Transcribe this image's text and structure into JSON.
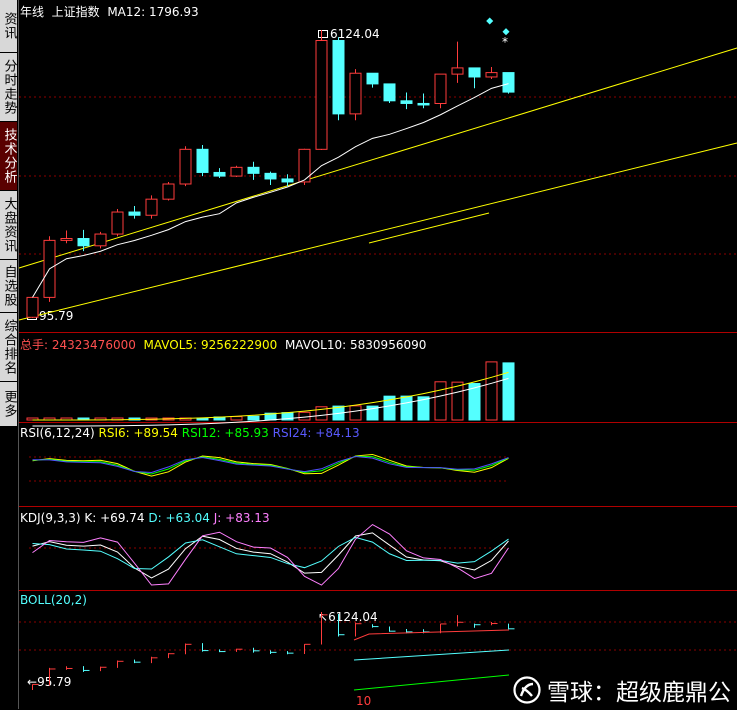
{
  "sidebar": {
    "tabs": [
      {
        "label": "资讯",
        "active": false
      },
      {
        "label": "分时走势",
        "active": false
      },
      {
        "label": "技术分析",
        "active": true
      },
      {
        "label": "大盘资讯",
        "active": false
      },
      {
        "label": "自选股",
        "active": false
      },
      {
        "label": "综合排名",
        "active": false
      },
      {
        "label": "更多",
        "active": false
      }
    ]
  },
  "main": {
    "period": "年线",
    "index_name": "上证指数",
    "ma_label": "MA12:",
    "ma_value": "1796.93",
    "high_label": "6124.04",
    "low_label": "95.79",
    "star": "*"
  },
  "volume": {
    "total_label": "总手:",
    "total_value": "24323476000",
    "mavol5_label": "MAVOL5:",
    "mavol5_value": "9256222900",
    "mavol10_label": "MAVOL10:",
    "mavol10_value": "5830956090"
  },
  "rsi": {
    "title": "RSI(6,12,24)",
    "rsi6_label": "RSI6:",
    "rsi6_value": "+89.54",
    "rsi12_label": "RSI12:",
    "rsi12_value": "+85.93",
    "rsi24_label": "RSI24:",
    "rsi24_value": "+84.13"
  },
  "kdj": {
    "title": "KDJ(9,3,3)",
    "k_label": "K:",
    "k_value": "+69.74",
    "d_label": "D:",
    "d_value": "+63.04",
    "j_label": "J:",
    "j_value": "+83.13"
  },
  "boll": {
    "title": "BOLL(20,2)",
    "high_label": "6124.04",
    "low_label": "95.79",
    "axis_tick": "10"
  },
  "watermark": {
    "text": "雪球：超级鹿鼎公"
  },
  "colors": {
    "up": "#ff3c3c",
    "down": "#54ffff",
    "yellow": "#ffff00",
    "white": "#ffffff",
    "green": "#00ff00",
    "blue": "#5050ff",
    "magenta": "#ff80ff",
    "grid": "#8b0000"
  },
  "chart_data": {
    "type": "candlestick",
    "period": "yearly",
    "candles": [
      {
        "o": 96,
        "h": 128,
        "l": 95,
        "c": 128
      },
      {
        "o": 128,
        "h": 310,
        "l": 120,
        "c": 292
      },
      {
        "o": 292,
        "h": 337,
        "l": 280,
        "c": 300
      },
      {
        "o": 300,
        "h": 340,
        "l": 250,
        "c": 270
      },
      {
        "o": 270,
        "h": 330,
        "l": 260,
        "c": 320
      },
      {
        "o": 320,
        "h": 460,
        "l": 310,
        "c": 440
      },
      {
        "o": 440,
        "h": 480,
        "l": 400,
        "c": 420
      },
      {
        "o": 420,
        "h": 560,
        "l": 400,
        "c": 530
      },
      {
        "o": 530,
        "h": 680,
        "l": 520,
        "c": 660
      },
      {
        "o": 660,
        "h": 1140,
        "l": 640,
        "c": 1090
      },
      {
        "o": 1090,
        "h": 1160,
        "l": 740,
        "c": 780
      },
      {
        "o": 780,
        "h": 830,
        "l": 720,
        "c": 740
      },
      {
        "o": 740,
        "h": 860,
        "l": 730,
        "c": 840
      },
      {
        "o": 840,
        "h": 910,
        "l": 700,
        "c": 770
      },
      {
        "o": 770,
        "h": 790,
        "l": 650,
        "c": 710
      },
      {
        "o": 710,
        "h": 760,
        "l": 640,
        "c": 680
      },
      {
        "o": 680,
        "h": 1100,
        "l": 650,
        "c": 1090
      },
      {
        "o": 1090,
        "h": 6124,
        "l": 1080,
        "c": 5260
      },
      {
        "o": 5260,
        "h": 5520,
        "l": 1660,
        "c": 1820
      },
      {
        "o": 1820,
        "h": 3478,
        "l": 1660,
        "c": 3277
      },
      {
        "o": 3277,
        "h": 3181,
        "l": 2661,
        "c": 2808
      },
      {
        "o": 2808,
        "h": 2826,
        "l": 2132,
        "c": 2199
      },
      {
        "o": 2199,
        "h": 2478,
        "l": 1949,
        "c": 2116
      },
      {
        "o": 2116,
        "h": 2444,
        "l": 1974,
        "c": 2115
      },
      {
        "o": 2115,
        "h": 3239,
        "l": 1974,
        "c": 3235
      },
      {
        "o": 3235,
        "h": 5178,
        "l": 2850,
        "c": 3539
      },
      {
        "o": 3539,
        "h": 3301,
        "l": 2638,
        "c": 3104
      },
      {
        "o": 3104,
        "h": 3587,
        "l": 3017,
        "c": 3307
      },
      {
        "o": 3307,
        "h": 3288,
        "l": 2440,
        "c": 2494
      }
    ]
  }
}
